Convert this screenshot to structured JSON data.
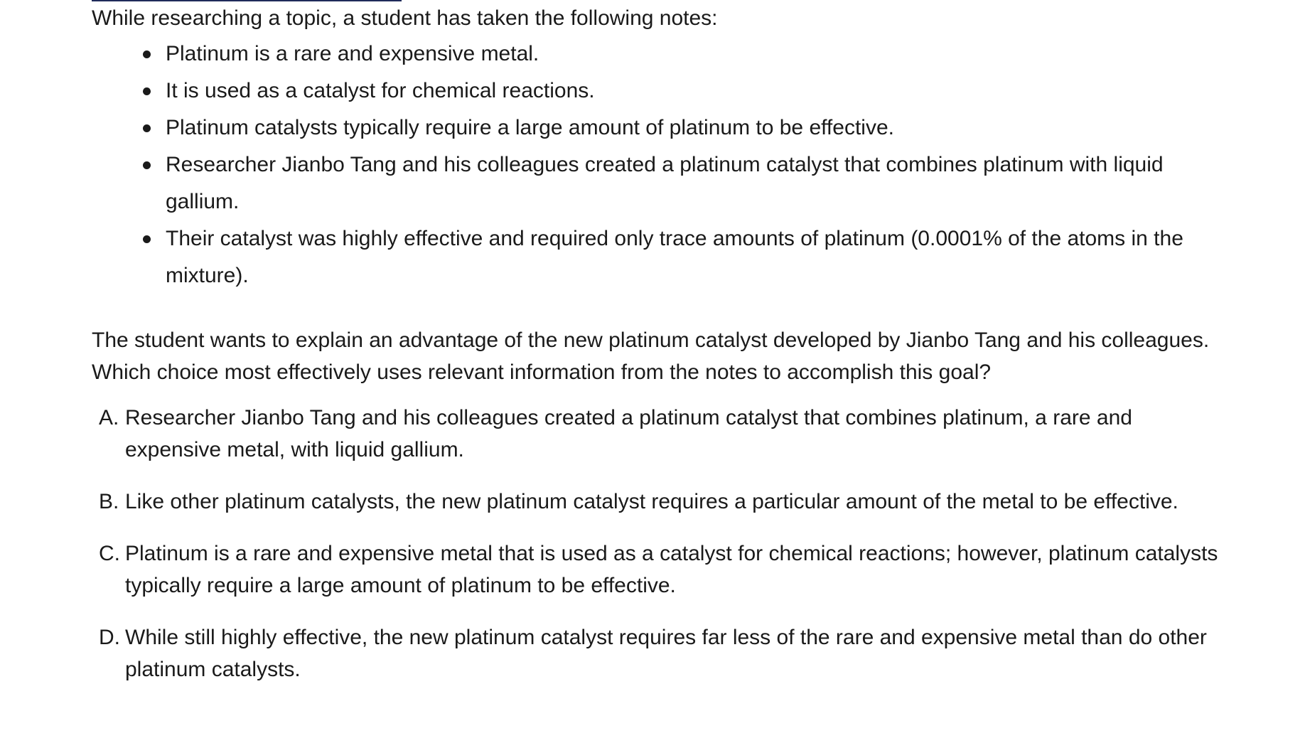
{
  "intro": "While researching a topic, a student has taken the following notes:",
  "notes": [
    "Platinum is a rare and expensive metal.",
    "It is used as a catalyst for chemical reactions.",
    "Platinum catalysts typically require a large amount of platinum to be effective.",
    "Researcher Jianbo Tang and his colleagues created a platinum catalyst that combines platinum with liquid gallium.",
    "Their catalyst was highly effective and required only trace amounts of platinum (0.0001% of the atoms in the mixture)."
  ],
  "question": "The student wants to explain an advantage of the new platinum catalyst developed by Jianbo Tang and his colleagues. Which choice most effectively uses relevant information from the notes to accomplish this goal?",
  "choices": [
    {
      "letter": "A.",
      "text": "Researcher Jianbo Tang and his colleagues created a platinum catalyst that combines platinum, a rare and expensive metal, with liquid gallium."
    },
    {
      "letter": "B.",
      "text": "Like other platinum catalysts, the new platinum catalyst requires a particular amount of the metal to be effective."
    },
    {
      "letter": "C.",
      "text": "Platinum is a rare and expensive metal that is used as a catalyst for chemical reactions; however, platinum catalysts typically require a large amount of platinum to be effective."
    },
    {
      "letter": "D.",
      "text": "While still highly effective, the new platinum catalyst requires far less of the rare and expensive metal than do other platinum catalysts."
    }
  ],
  "colors": {
    "text": "#1a1a1a",
    "top_rule": "#1f2a5a",
    "background": "#ffffff"
  }
}
